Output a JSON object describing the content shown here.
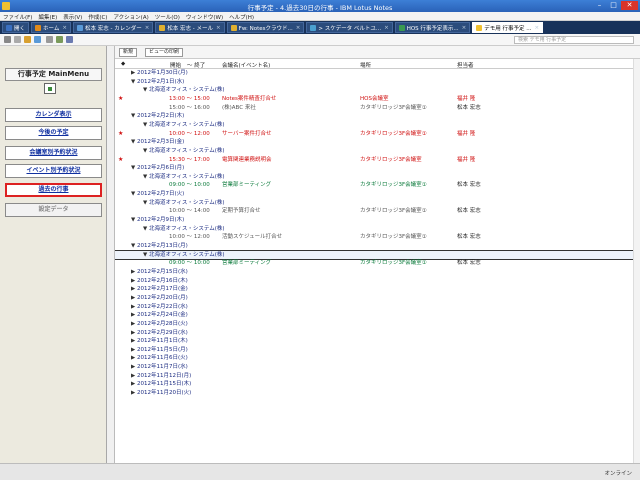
{
  "window": {
    "title": "行事予定 - 4.過去30日の行事 - IBM Lotus Notes"
  },
  "menu": [
    "ファイル(F)",
    "編集(E)",
    "表示(V)",
    "作成(C)",
    "アクション(A)",
    "ツール(O)",
    "ウィンドウ(W)",
    "ヘルプ(H)"
  ],
  "tabs": [
    {
      "label": "開く",
      "color": "#3a6fc0"
    },
    {
      "label": "ホーム",
      "color": "#e08a1a"
    },
    {
      "label": "松本 宏志 - カレンダー",
      "color": "#5a9ad8"
    },
    {
      "label": "松本 宏志 - メール",
      "color": "#e0b030"
    },
    {
      "label": "Fw: Notesクラウド...",
      "color": "#e0b030"
    },
    {
      "label": "> スケデータ ベルトユ...",
      "color": "#4aa0d0"
    },
    {
      "label": "HOS 行事予定表示...",
      "color": "#3a9a50"
    },
    {
      "label": "デモ用 行事予定 ...",
      "color": "#f0c030"
    }
  ],
  "search": {
    "placeholder": "検索 デモ用 行事予定"
  },
  "sidebar": {
    "title": "行事予定 MainMenu",
    "items": [
      "カレンダ表示",
      "今後の予定",
      "会議室別予約状況",
      "イベント別予約状況",
      "過去の行事",
      "設定データ"
    ]
  },
  "actions": {
    "new": "新規",
    "print": "ビューの印刷"
  },
  "columns": {
    "start": "開始",
    "end": "～ 終了",
    "name": "会議名(イベント名)",
    "place": "場所",
    "resp": "担当者"
  },
  "rows": [
    {
      "type": "date",
      "open": false,
      "text": "2012年1月30日(月)"
    },
    {
      "type": "date",
      "open": true,
      "text": "2012年2月1日(水)"
    },
    {
      "type": "org",
      "text": "北海道オフィス・システム(株)"
    },
    {
      "type": "ev",
      "style": "red",
      "flag": true,
      "time": "13:00 ～ 15:00",
      "name": "Notes案件精査打合せ",
      "place": "HOS会議室",
      "resp": "福井 隆"
    },
    {
      "type": "ev",
      "style": "gray",
      "flag": false,
      "time": "15:00 ～ 16:00",
      "name": "(株)ABC 来社",
      "place": "カタギリロッジ3F会議室①",
      "resp": "松本 宏志"
    },
    {
      "type": "date",
      "open": true,
      "text": "2012年2月2日(木)"
    },
    {
      "type": "org",
      "text": "北海道オフィス・システム(株)"
    },
    {
      "type": "ev",
      "style": "red",
      "flag": true,
      "time": "10:00 ～ 12:00",
      "name": "サーバー案件打合せ",
      "place": "カタギリロッジ3F会議室①",
      "resp": "福井 隆"
    },
    {
      "type": "date",
      "open": true,
      "text": "2012年2月3日(金)"
    },
    {
      "type": "org",
      "text": "北海道オフィス・システム(株)"
    },
    {
      "type": "ev",
      "style": "red",
      "flag": true,
      "time": "15:30 ～ 17:00",
      "name": "電算関連業務説明会",
      "place": "カタギリロッジ3F会議室",
      "resp": "福井 隆"
    },
    {
      "type": "date",
      "open": true,
      "text": "2012年2月6日(月)"
    },
    {
      "type": "org",
      "text": "北海道オフィス・システム(株)"
    },
    {
      "type": "ev",
      "style": "green",
      "flag": false,
      "time": "09:00 ～ 10:00",
      "name": "営業部ミーティング",
      "place": "カタギリロッジ3F会議室①",
      "resp": "松本 宏志"
    },
    {
      "type": "date",
      "open": true,
      "text": "2012年2月7日(火)"
    },
    {
      "type": "org",
      "text": "北海道オフィス・システム(株)"
    },
    {
      "type": "ev",
      "style": "gray",
      "flag": false,
      "time": "10:00 ～ 14:00",
      "name": "定期予算打合せ",
      "place": "カタギリロッジ3F会議室①",
      "resp": "松本 宏志"
    },
    {
      "type": "date",
      "open": true,
      "text": "2012年2月9日(木)"
    },
    {
      "type": "org",
      "text": "北海道オフィス・システム(株)"
    },
    {
      "type": "ev",
      "style": "gray",
      "flag": false,
      "time": "10:00 ～ 12:00",
      "name": "活動スケジュール打合せ",
      "place": "カタギリロッジ3F会議室①",
      "resp": "松本 宏志"
    },
    {
      "type": "date",
      "open": true,
      "text": "2012年2月13日(月)"
    },
    {
      "type": "org",
      "text": "北海道オフィス・システム(株)",
      "selected": true
    },
    {
      "type": "ev",
      "style": "green",
      "flag": false,
      "time": "09:00 ～ 10:00",
      "name": "営業部ミーティング",
      "place": "カタギリロッジ3F会議室①",
      "resp": "松本 宏志"
    },
    {
      "type": "date",
      "open": false,
      "text": "2012年2月15日(水)"
    },
    {
      "type": "date",
      "open": false,
      "text": "2012年2月16日(木)"
    },
    {
      "type": "date",
      "open": false,
      "text": "2012年2月17日(金)"
    },
    {
      "type": "date",
      "open": false,
      "text": "2012年2月20日(月)"
    },
    {
      "type": "date",
      "open": false,
      "text": "2012年2月22日(水)"
    },
    {
      "type": "date",
      "open": false,
      "text": "2012年2月24日(金)"
    },
    {
      "type": "date",
      "open": false,
      "text": "2012年2月28日(火)"
    },
    {
      "type": "date",
      "open": false,
      "text": "2012年2月29日(水)"
    },
    {
      "type": "date",
      "open": false,
      "text": "2012年11月1日(木)"
    },
    {
      "type": "date",
      "open": false,
      "text": "2012年11月5日(月)"
    },
    {
      "type": "date",
      "open": false,
      "text": "2012年11月6日(火)"
    },
    {
      "type": "date",
      "open": false,
      "text": "2012年11月7日(水)"
    },
    {
      "type": "date",
      "open": false,
      "text": "2012年11月12日(月)"
    },
    {
      "type": "date",
      "open": false,
      "text": "2012年11月15日(木)"
    },
    {
      "type": "date",
      "open": false,
      "text": "2012年11月20日(火)"
    }
  ],
  "status": {
    "online": "オンライン"
  }
}
